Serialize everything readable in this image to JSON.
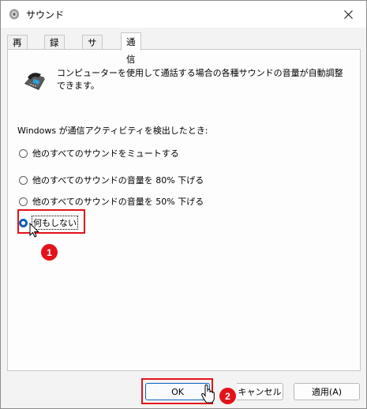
{
  "window": {
    "title": "サウンド",
    "close_icon": "close-icon"
  },
  "tabs": [
    {
      "label": "再生"
    },
    {
      "label": "録音"
    },
    {
      "label": "サウンド"
    },
    {
      "label": "通信",
      "active": true
    }
  ],
  "panel": {
    "description": "コンピューターを使用して通話する場合の各種サウンドの音量が自動調整できます。",
    "prompt": "Windows が通信アクティビティを検出したとき:",
    "options": [
      {
        "label": "他のすべてのサウンドをミュートする",
        "checked": false
      },
      {
        "label": "他のすべてのサウンドの音量を 80% 下げる",
        "checked": false
      },
      {
        "label": "他のすべてのサウンドの音量を 50% 下げる",
        "checked": false
      },
      {
        "label": "何もしない",
        "checked": true
      }
    ]
  },
  "buttons": {
    "ok": "OK",
    "cancel": "キャンセル",
    "apply": "適用(A)"
  },
  "annotations": {
    "step1": "1",
    "step2": "2"
  },
  "colors": {
    "accent": "#0a63bd",
    "highlight": "#e3131b"
  }
}
